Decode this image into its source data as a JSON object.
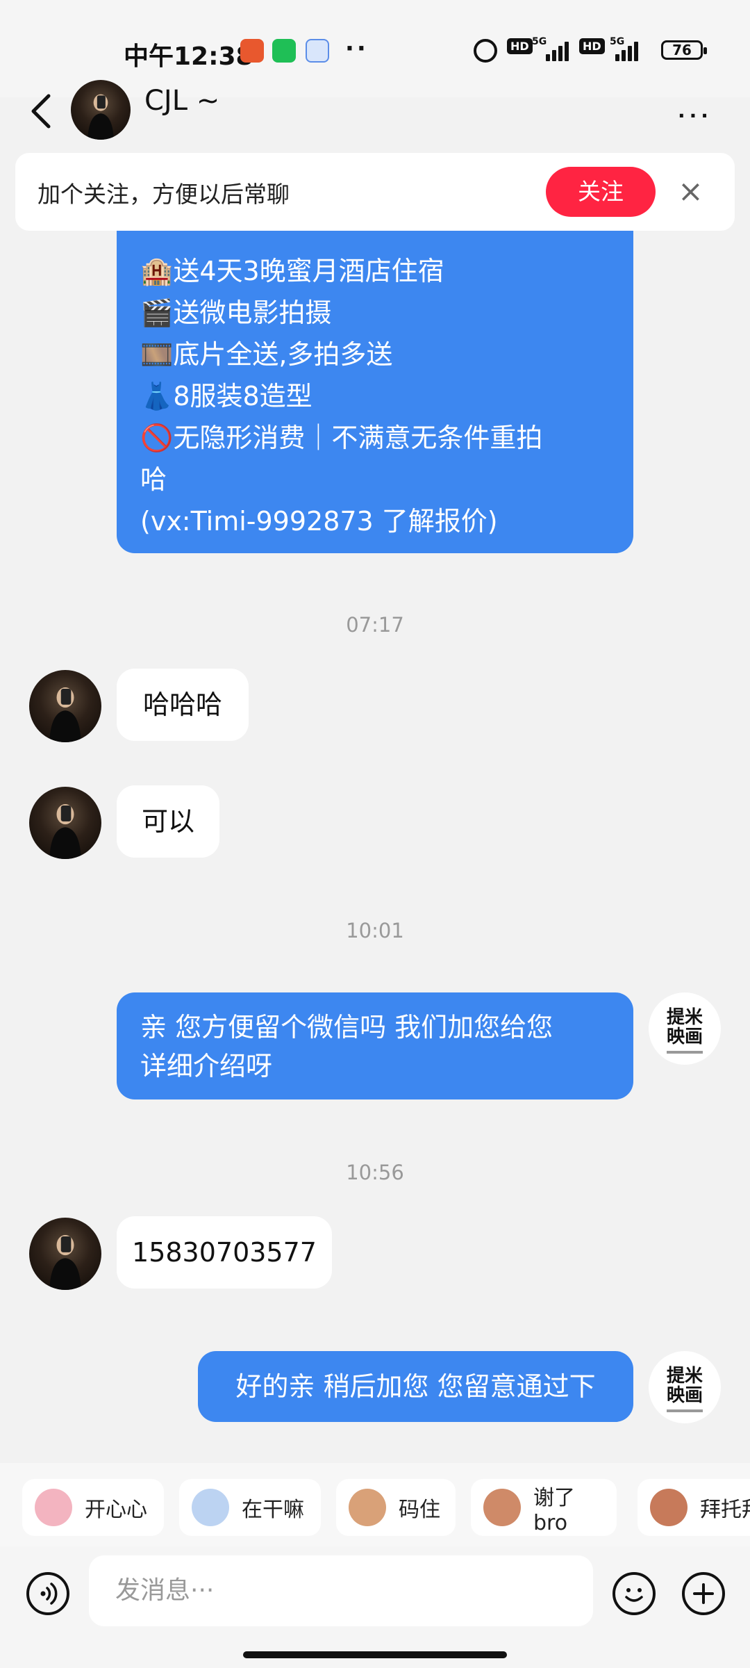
{
  "status_bar": {
    "time": "中午12:38",
    "dots": "··",
    "net1": "5G",
    "net2": "5G",
    "hd": "HD",
    "battery": "76"
  },
  "header": {
    "contact_name": "CJL ~",
    "more": "···"
  },
  "follow_banner": {
    "text": "加个关注，方便以后常聊",
    "button": "关注",
    "close": "×"
  },
  "promo_message": {
    "lines": [
      "🏨送4天3晚蜜月酒店住宿",
      "🎬送微电影拍摄",
      "🎞️底片全送,多拍多送",
      "👗8服装8造型",
      "🚫无隐形消费｜不满意无条件重拍",
      "哈",
      "(vx:Timi-9992873 了解报价)"
    ]
  },
  "timestamps": [
    "07:17",
    "10:01",
    "10:56"
  ],
  "messages": [
    {
      "side": "left",
      "text": "哈哈哈"
    },
    {
      "side": "left",
      "text": "可以"
    },
    {
      "side": "right",
      "text": "亲 您方便留个微信吗 我们加您给您详细介绍呀"
    },
    {
      "side": "left",
      "text": "15830703577"
    },
    {
      "side": "right",
      "text": "好的亲 稍后加您 您留意通过下"
    }
  ],
  "message_lines": {
    "m3_line1": "亲 您方便留个微信吗 我们加您给您",
    "m3_line2": "详细介绍呀"
  },
  "brand_avatar_text": "提米\n映画",
  "quick_replies": [
    "开心心",
    "在干嘛",
    "码住",
    "谢了bro",
    "拜托拜"
  ],
  "input": {
    "placeholder": "发消息···"
  },
  "colors": {
    "accent_red": "#ff2442",
    "bubble_blue": "#3d87f0"
  }
}
